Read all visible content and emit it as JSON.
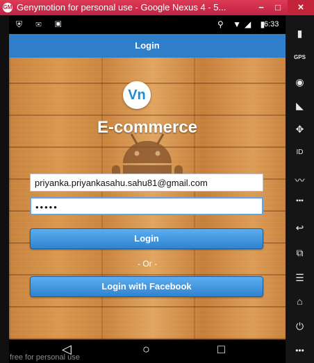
{
  "window": {
    "title": "Genymotion for personal use - Google Nexus 4 - 5...",
    "app_icon": "genymotion-icon",
    "minimize": "−",
    "maximize": "□",
    "close": "×"
  },
  "statusbar": {
    "left_icons": "⛨ ✉ ▣",
    "right_icons": "⚲ ▼◢ ▮",
    "time": "6:33"
  },
  "actionbar": {
    "title": "Login"
  },
  "main": {
    "logo_text": "Vn",
    "app_name": "E-commerce",
    "email_value": "priyanka.priyankasahu.sahu81@gmail.com",
    "password_value": "•••••",
    "login_button": "Login",
    "or_text": "- Or -",
    "facebook_button": "Login with Facebook"
  },
  "navbar": {
    "back": "◁",
    "home": "○",
    "recents": "□",
    "watermark": "free for personal use"
  },
  "sidebar": {
    "icons": [
      {
        "name": "battery-icon",
        "glyph": "▮"
      },
      {
        "name": "gps-icon",
        "glyph": "GPS"
      },
      {
        "name": "webcam-icon",
        "glyph": "◉"
      },
      {
        "name": "rotate-icon",
        "glyph": "◣"
      },
      {
        "name": "dpad-icon",
        "glyph": "✥"
      },
      {
        "name": "id-icon",
        "glyph": "ID"
      },
      {
        "name": "network-icon",
        "glyph": "〰"
      },
      {
        "name": "sms-icon",
        "glyph": "▪▪▪"
      },
      {
        "name": "back-icon",
        "glyph": "↩"
      },
      {
        "name": "recent-apps-icon",
        "glyph": "⧉"
      },
      {
        "name": "menu-icon",
        "glyph": "☰"
      },
      {
        "name": "home-icon",
        "glyph": "⌂"
      },
      {
        "name": "power-icon",
        "glyph": "⏻"
      },
      {
        "name": "more-icon",
        "glyph": "•••"
      }
    ]
  },
  "colors": {
    "titlebar": "#c02242",
    "actionbar": "#2f7ec9",
    "button": "#3b8fd9",
    "logo_text": "#1a8fcf"
  }
}
